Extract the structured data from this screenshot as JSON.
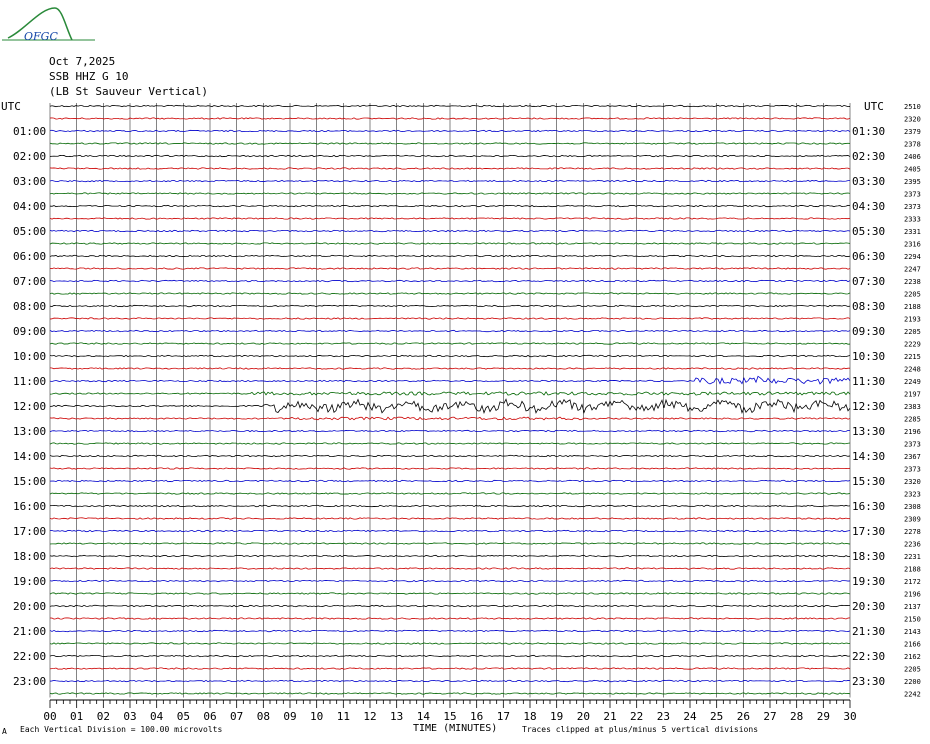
{
  "header": {
    "logo_text": "OFGC",
    "date": "Oct 7,2025",
    "station": "SSB HHZ G 10",
    "location": "(LB St Sauveur Vertical)"
  },
  "left_label_title": "UTC",
  "right_label_title": "UTC",
  "footer": {
    "division_note": "Each Vertical Division =  100.00 microvolts",
    "clip_note": "Traces clipped at plus/minus 5 vertical divisions",
    "corner_mark": "A"
  },
  "colors": {
    "trace_cycle": [
      "#000000",
      "#cc0000",
      "#0000cc",
      "#006600"
    ],
    "grid": "#333333",
    "logo": "#2a8a3a"
  },
  "chart_data": {
    "type": "helicorder",
    "xlabel": "TIME (MINUTES)",
    "xlim": [
      0,
      30
    ],
    "x_ticks": [
      "00",
      "01",
      "02",
      "03",
      "04",
      "05",
      "06",
      "07",
      "08",
      "09",
      "10",
      "11",
      "12",
      "13",
      "14",
      "15",
      "16",
      "17",
      "18",
      "19",
      "20",
      "21",
      "22",
      "23",
      "24",
      "25",
      "26",
      "27",
      "28",
      "29",
      "30"
    ],
    "left_hour_labels": [
      "01:00",
      "02:00",
      "03:00",
      "04:00",
      "05:00",
      "06:00",
      "07:00",
      "08:00",
      "09:00",
      "10:00",
      "11:00",
      "12:00",
      "13:00",
      "14:00",
      "15:00",
      "16:00",
      "17:00",
      "18:00",
      "19:00",
      "20:00",
      "21:00",
      "22:00",
      "23:00"
    ],
    "right_hour_labels": [
      "01:30",
      "02:30",
      "03:30",
      "04:30",
      "05:30",
      "06:30",
      "07:30",
      "08:30",
      "09:30",
      "10:30",
      "11:30",
      "12:30",
      "13:30",
      "14:30",
      "15:30",
      "16:30",
      "17:30",
      "18:30",
      "19:30",
      "20:30",
      "21:30",
      "22:30",
      "23:30"
    ],
    "right_values": [
      "2510",
      "2320",
      "2379",
      "2378",
      "2406",
      "2405",
      "2395",
      "2373",
      "2373",
      "2333",
      "2331",
      "2316",
      "2294",
      "2247",
      "2238",
      "2205",
      "2188",
      "2193",
      "2205",
      "2229",
      "2215",
      "2248",
      "2249",
      "2197",
      "2383",
      "2285",
      "2196",
      "2373",
      "2367",
      "2373",
      "2320",
      "2323",
      "2308",
      "2309",
      "2278",
      "2236",
      "2231",
      "2188",
      "2172",
      "2196",
      "2137",
      "2150",
      "2143",
      "2166",
      "2162",
      "2205",
      "2200",
      "2242"
    ],
    "events": [
      {
        "trace": 22,
        "start_min": 24.2,
        "end_min": 30,
        "amp": 3.0
      },
      {
        "trace": 22,
        "start_min": 26.5,
        "end_min": 26.7,
        "amp": 7.0
      },
      {
        "trace": 23,
        "start_min": 7.5,
        "end_min": 30,
        "amp": 1.6
      },
      {
        "trace": 24,
        "start_min": 8.0,
        "end_min": 30,
        "amp": 4.5
      },
      {
        "trace": 25,
        "start_min": 9.0,
        "end_min": 20,
        "amp": 1.4
      }
    ]
  }
}
